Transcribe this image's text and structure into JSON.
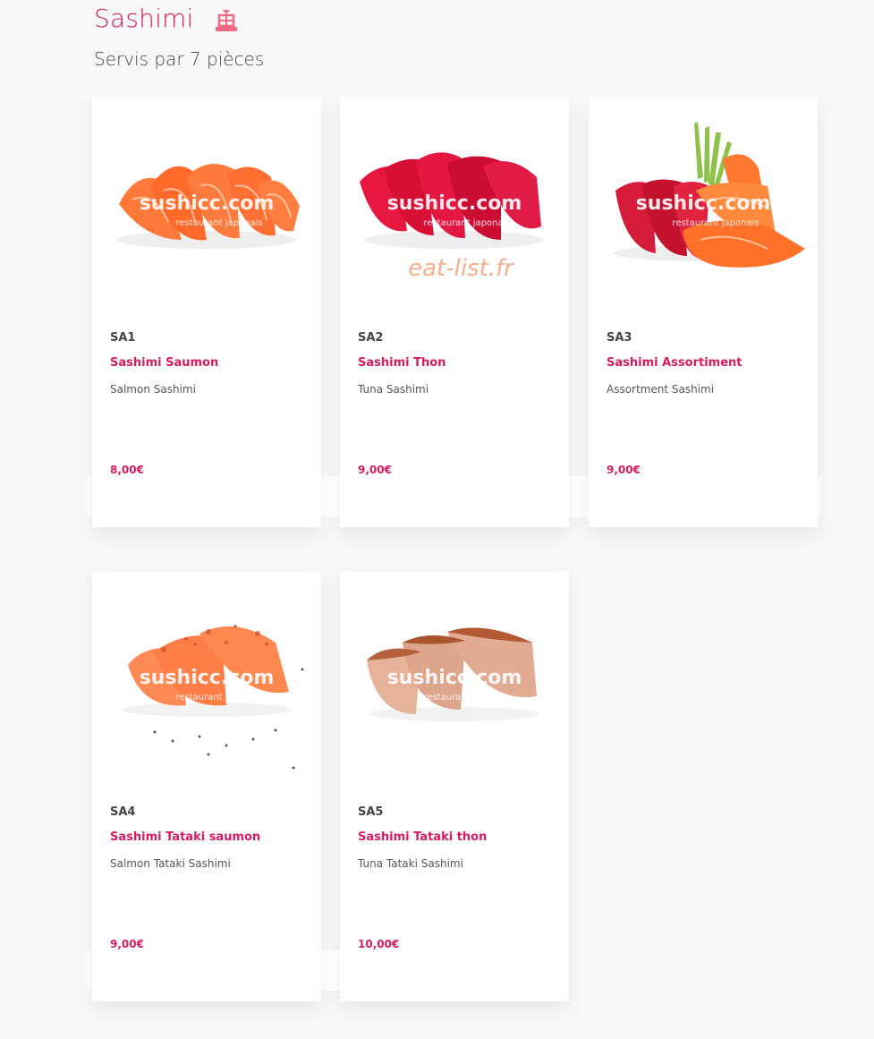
{
  "section": {
    "title": "Sashimi",
    "icon": "fish-kanji-icon",
    "subtitle": "Servis par 7 pièces"
  },
  "colors": {
    "accent": "#d81b60",
    "background": "#f8f8f8",
    "card": "#ffffff"
  },
  "watermark": {
    "brand": "sushicc.com",
    "tagline": "restaurant japonais",
    "overlay": "eat-list.fr"
  },
  "items": [
    {
      "code": "SA1",
      "name": "Sashimi Saumon",
      "description": "Salmon Sashimi",
      "price": "8,00€"
    },
    {
      "code": "SA2",
      "name": "Sashimi Thon",
      "description": "Tuna Sashimi",
      "price": "9,00€"
    },
    {
      "code": "SA3",
      "name": "Sashimi Assortiment",
      "description": "Assortment Sashimi",
      "price": "9,00€"
    },
    {
      "code": "SA4",
      "name": "Sashimi Tataki saumon",
      "description": "Salmon Tataki Sashimi",
      "price": "9,00€"
    },
    {
      "code": "SA5",
      "name": "Sashimi Tataki thon",
      "description": "Tuna Tataki Sashimi",
      "price": "10,00€"
    }
  ]
}
